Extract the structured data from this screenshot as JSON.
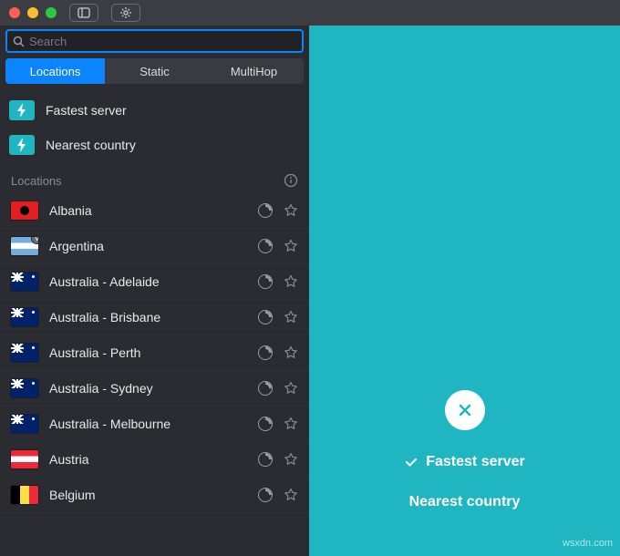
{
  "search": {
    "placeholder": "Search"
  },
  "tabs": [
    {
      "label": "Locations",
      "active": true
    },
    {
      "label": "Static",
      "active": false
    },
    {
      "label": "MultiHop",
      "active": false
    }
  ],
  "quick": [
    {
      "icon": "lightning-icon",
      "label": "Fastest server"
    },
    {
      "icon": "lightning-icon",
      "label": "Nearest country"
    }
  ],
  "section_header": "Locations",
  "locations": [
    {
      "name": "Albania",
      "flag": "al",
      "badge": false
    },
    {
      "name": "Argentina",
      "flag": "ar",
      "badge": true
    },
    {
      "name": "Australia - Adelaide",
      "flag": "au",
      "badge": false
    },
    {
      "name": "Australia - Brisbane",
      "flag": "au",
      "badge": false
    },
    {
      "name": "Australia - Perth",
      "flag": "au",
      "badge": false
    },
    {
      "name": "Australia - Sydney",
      "flag": "au",
      "badge": false
    },
    {
      "name": "Australia - Melbourne",
      "flag": "au",
      "badge": false
    },
    {
      "name": "Austria",
      "flag": "at",
      "badge": false
    },
    {
      "name": "Belgium",
      "flag": "be",
      "badge": false
    }
  ],
  "main": {
    "option1": "Fastest server",
    "option2": "Nearest country"
  },
  "watermark": "wsxdn.com",
  "colors": {
    "accent": "#1fb6c1",
    "tab_active": "#0a84ff",
    "sidebar_bg": "#2b2c31"
  }
}
